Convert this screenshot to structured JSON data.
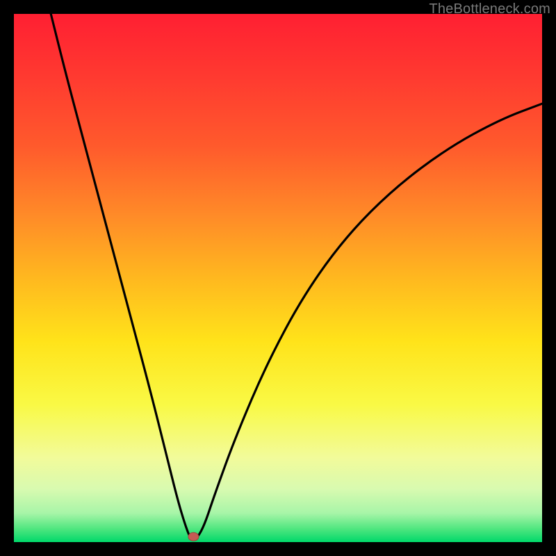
{
  "watermark": "TheBottleneck.com",
  "colors": {
    "bg": "#000000",
    "curve": "#000000",
    "dot_fill": "#c65a54",
    "dot_stroke": "#9e433f",
    "gradient_stops": [
      {
        "offset": 0.0,
        "color": "#ff1f32"
      },
      {
        "offset": 0.12,
        "color": "#ff3a30"
      },
      {
        "offset": 0.25,
        "color": "#ff5a2c"
      },
      {
        "offset": 0.38,
        "color": "#ff8a28"
      },
      {
        "offset": 0.5,
        "color": "#ffb81f"
      },
      {
        "offset": 0.62,
        "color": "#ffe31a"
      },
      {
        "offset": 0.74,
        "color": "#f9f945"
      },
      {
        "offset": 0.84,
        "color": "#f2fb9a"
      },
      {
        "offset": 0.9,
        "color": "#d8fab0"
      },
      {
        "offset": 0.945,
        "color": "#a8f5a8"
      },
      {
        "offset": 0.975,
        "color": "#4fe67f"
      },
      {
        "offset": 1.0,
        "color": "#00d86a"
      }
    ]
  },
  "chart_data": {
    "type": "line",
    "title": "",
    "xlabel": "",
    "ylabel": "",
    "xlim": [
      0,
      100
    ],
    "ylim": [
      0,
      100
    ],
    "series": [
      {
        "name": "bottleneck-curve",
        "x": [
          7,
          10,
          14,
          18,
          22,
          26,
          29,
          31,
          32.5,
          33.5,
          34.5,
          36,
          38,
          42,
          48,
          55,
          63,
          72,
          82,
          92,
          100
        ],
        "y": [
          100,
          88,
          73,
          58,
          43,
          28,
          16,
          8,
          3,
          0.5,
          0.5,
          3,
          9,
          20,
          34,
          47,
          58,
          67,
          74.5,
          80,
          83
        ]
      }
    ],
    "annotations": [
      {
        "name": "min-dot",
        "x": 34,
        "y": 0.5
      }
    ],
    "legend": false,
    "grid": false
  }
}
